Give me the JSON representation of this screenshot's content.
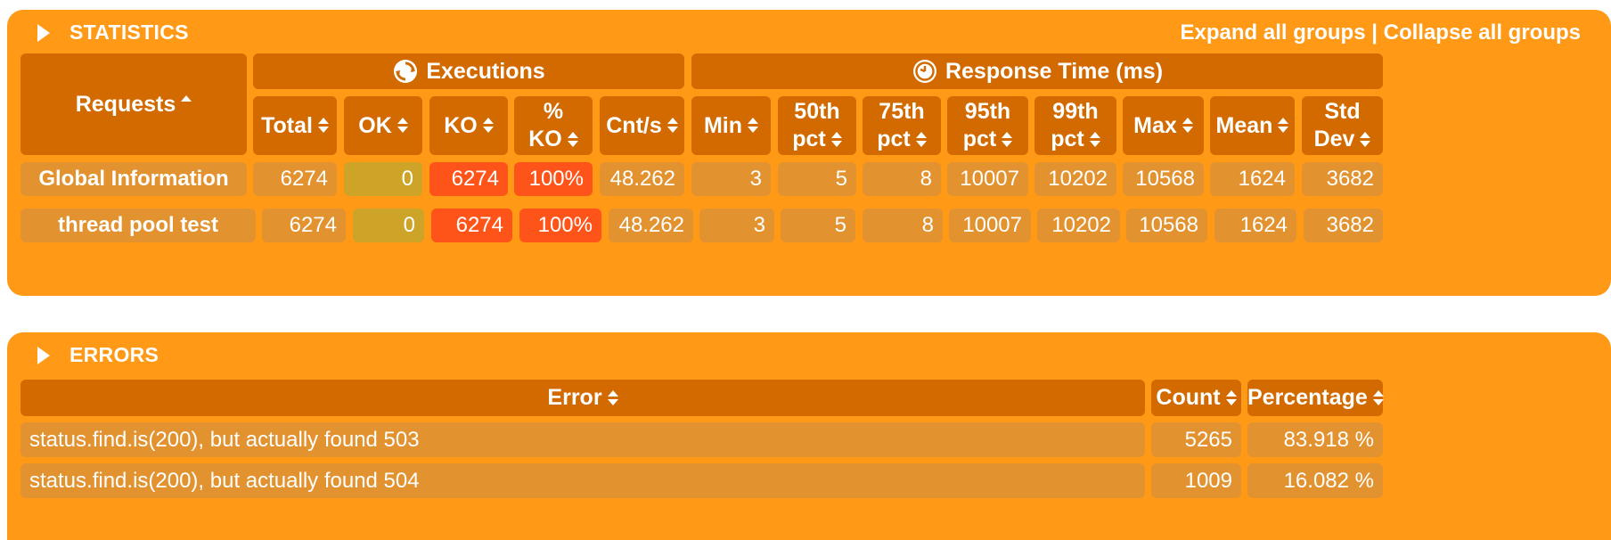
{
  "statistics": {
    "title": "STATISTICS",
    "expand_label": "Expand all groups",
    "separator": "|",
    "collapse_label": "Collapse all groups",
    "requests_header": "Requests",
    "executions_header": "Executions",
    "response_time_header": "Response Time (ms)",
    "columns": {
      "total": "Total",
      "ok": "OK",
      "ko": "KO",
      "pct_ko_1": "%",
      "pct_ko_2": "KO",
      "cnt_s": "Cnt/s",
      "min": "Min",
      "p50_1": "50th",
      "p50_2": "pct",
      "p75_1": "75th",
      "p75_2": "pct",
      "p95_1": "95th",
      "p95_2": "pct",
      "p99_1": "99th",
      "p99_2": "pct",
      "max": "Max",
      "mean": "Mean",
      "std_1": "Std",
      "std_2": "Dev"
    },
    "rows": [
      {
        "name": "Global Information",
        "total": "6274",
        "ok": "0",
        "ko": "6274",
        "pct_ko": "100%",
        "cnt_s": "48.262",
        "min": "3",
        "p50": "5",
        "p75": "8",
        "p95": "10007",
        "p99": "10202",
        "max": "10568",
        "mean": "1624",
        "std": "3682"
      },
      {
        "name": "thread pool test",
        "total": "6274",
        "ok": "0",
        "ko": "6274",
        "pct_ko": "100%",
        "cnt_s": "48.262",
        "min": "3",
        "p50": "5",
        "p75": "8",
        "p95": "10007",
        "p99": "10202",
        "max": "10568",
        "mean": "1624",
        "std": "3682"
      }
    ]
  },
  "errors": {
    "title": "ERRORS",
    "columns": {
      "error": "Error",
      "count": "Count",
      "percentage": "Percentage"
    },
    "rows": [
      {
        "error": "status.find.is(200), but actually found 503",
        "count": "5265",
        "percentage": "83.918 %"
      },
      {
        "error": "status.find.is(200), but actually found 504",
        "count": "1009",
        "percentage": "16.082 %"
      }
    ]
  },
  "colors": {
    "panel": "#ff9916",
    "header_cell": "#d26a00",
    "data_cell": "#e39230",
    "ok_cell": "#cda427",
    "ko_cell": "#ff5419"
  },
  "icons": [
    "triangle-right-icon",
    "refresh-icon",
    "clock-icon",
    "sort-icon",
    "sort-asc-icon"
  ]
}
